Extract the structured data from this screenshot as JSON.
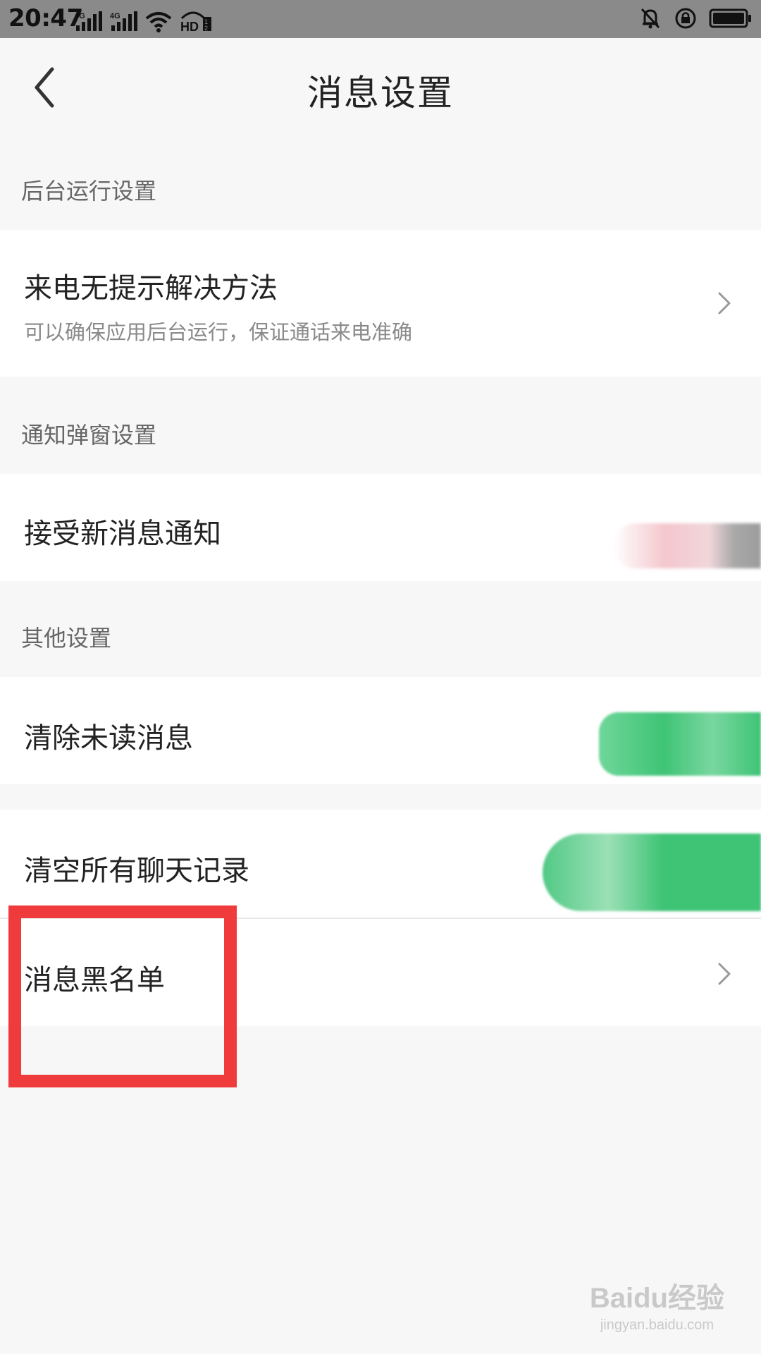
{
  "status_bar": {
    "time": "20:47",
    "icons": [
      "signal-4g-icon",
      "signal-4g-icon",
      "wifi-icon",
      "hd-icon",
      "bell-muted-icon",
      "rotation-lock-icon",
      "battery-icon"
    ]
  },
  "header": {
    "title": "消息设置",
    "back_icon": "chevron-left-icon"
  },
  "sections": [
    {
      "header": "后台运行设置",
      "items": [
        {
          "title": "来电无提示解决方法",
          "subtitle": "可以确保应用后台运行，保证通话来电准确",
          "action": "chevron-right-icon"
        }
      ]
    },
    {
      "header": "通知弹窗设置",
      "items": [
        {
          "title": "接受新消息通知",
          "action": "toggle-obscured"
        }
      ]
    },
    {
      "header": "其他设置",
      "items": [
        {
          "title": "清除未读消息",
          "action": "button-obscured"
        },
        {
          "title": "清空所有聊天记录",
          "action": "button-obscured"
        },
        {
          "title": "消息黑名单",
          "action": "chevron-right-icon"
        }
      ]
    }
  ],
  "watermark": {
    "logo": "Baidu经验",
    "url": "jingyan.baidu.com"
  },
  "colors": {
    "status_bar_bg": "#8a8a8a",
    "page_bg": "#f7f7f7",
    "row_bg": "#ffffff",
    "highlight": "#ef3b3b",
    "obscure_green": "#3fc476",
    "obscure_pink": "#f4c7cd"
  }
}
